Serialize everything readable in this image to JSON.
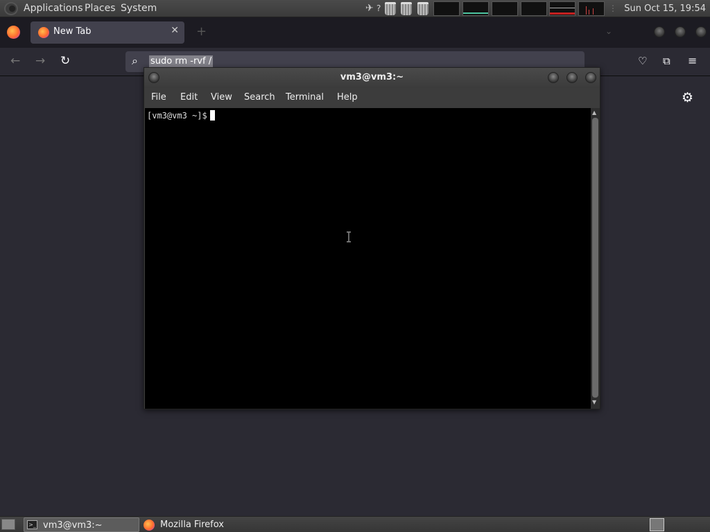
{
  "top_panel": {
    "menus": [
      "Applications",
      "Places",
      "System"
    ],
    "help_glyph": "?",
    "clock": "Sun Oct 15, 19:54"
  },
  "firefox": {
    "tab_title": "New Tab",
    "url_value": "sudo rm -rvf /",
    "icons": [
      "firefox-icon",
      "back-icon",
      "forward-icon",
      "reload-icon",
      "pocket-icon",
      "extensions-icon",
      "menu-icon",
      "settings-gear-icon"
    ]
  },
  "terminal": {
    "title": "vm3@vm3:~",
    "menus": [
      "File",
      "Edit",
      "View",
      "Search",
      "Terminal",
      "Help"
    ],
    "prompt": "[vm3@vm3 ~]$"
  },
  "taskbar": {
    "tasks": [
      "vm3@vm3:~",
      "Mozilla Firefox"
    ]
  },
  "colors": {
    "firefox_bg": "#2b2a33",
    "firefox_tabstrip": "#1c1b22",
    "terminal_bg": "#000000",
    "panel_bg": "#3a3a3a"
  }
}
